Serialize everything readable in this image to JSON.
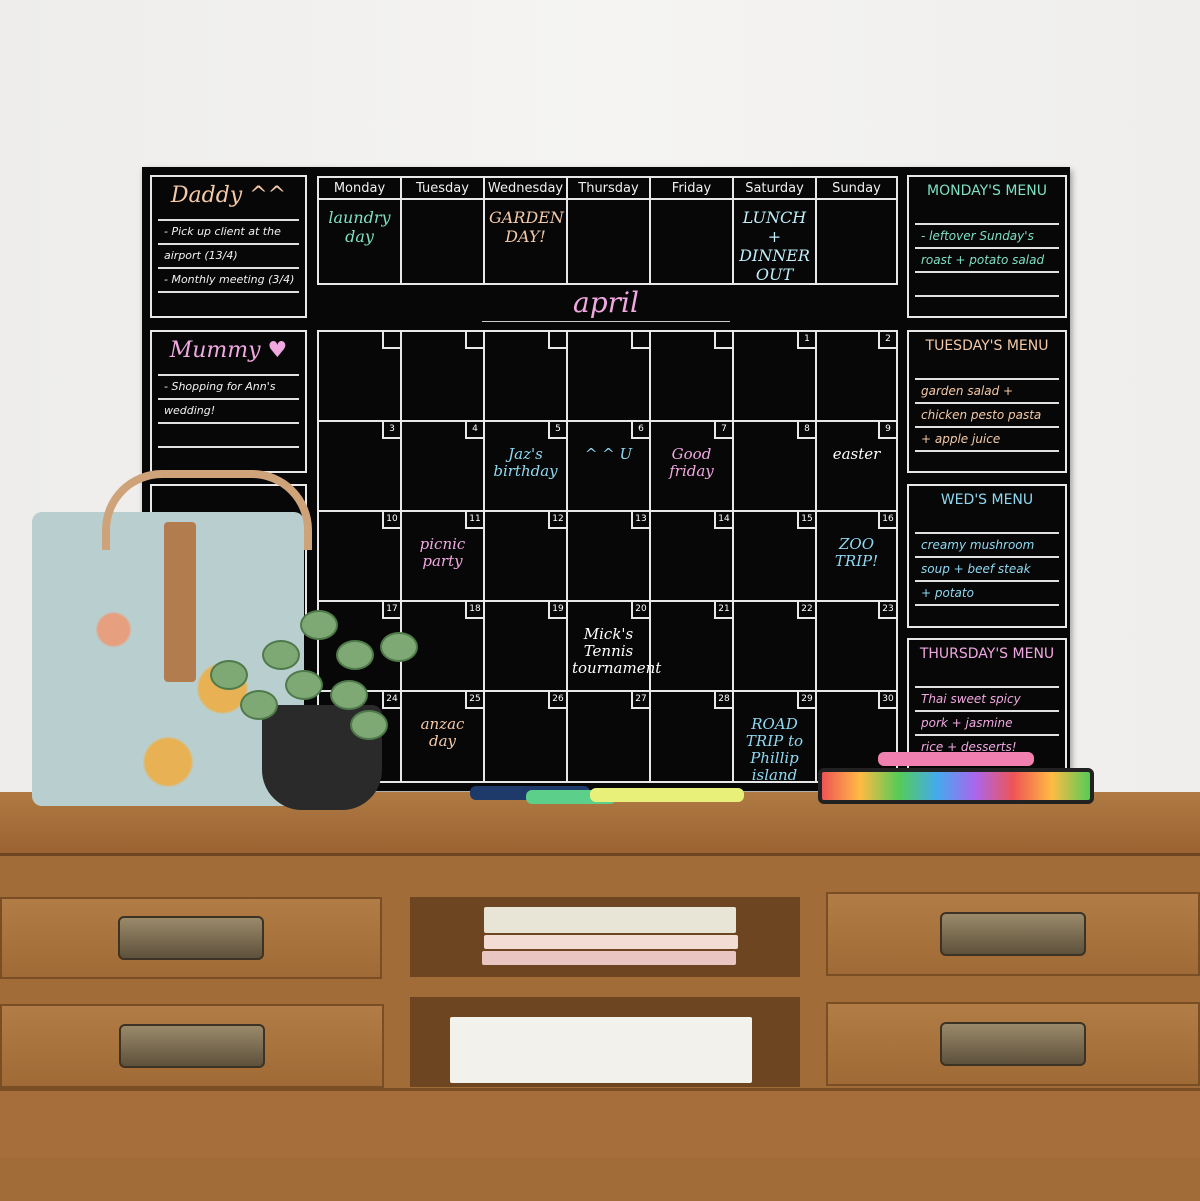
{
  "planner": {
    "daddy": {
      "title": "Daddy ^^",
      "lines": [
        "- Pick up client at the",
        "airport (13/4)",
        "- Monthly meeting (3/4)",
        ""
      ]
    },
    "mummy": {
      "title": "Mummy ♥",
      "lines": [
        "- Shopping for Ann's",
        "wedding!",
        "",
        ""
      ]
    },
    "week": {
      "days": [
        "Monday",
        "Tuesday",
        "Wednesday",
        "Thursday",
        "Friday",
        "Saturday",
        "Sunday"
      ],
      "events": [
        "laundry day",
        "",
        "GARDEN DAY!",
        "",
        "",
        "LUNCH + DINNER OUT",
        ""
      ]
    },
    "month": "april",
    "calendar": {
      "numbers": [
        "",
        "",
        "",
        "",
        "",
        "1",
        "2",
        "3",
        "4",
        "5",
        "6",
        "7",
        "8",
        "9",
        "10",
        "11",
        "12",
        "13",
        "14",
        "15",
        "16",
        "17",
        "18",
        "19",
        "20",
        "21",
        "22",
        "23",
        "24",
        "25",
        "26",
        "27",
        "28",
        "29",
        "30"
      ],
      "events": {
        "5": "Jaz's birthday",
        "7": "Good friday",
        "9": "easter",
        "11": "picnic party",
        "16": "ZOO TRIP!",
        "20": "Mick's Tennis tournament",
        "25": "anzac day",
        "29": "ROAD TRIP to Phillip island",
        "6": "^ ^ U"
      }
    },
    "menus": [
      {
        "title": "MONDAY'S MENU",
        "color": "#7fe0c4",
        "lines": [
          "- leftover Sunday's",
          "roast + potato salad",
          "",
          ""
        ]
      },
      {
        "title": "TUESDAY'S MENU",
        "color": "#f3c9a8",
        "lines": [
          "garden salad +",
          "chicken pesto pasta",
          "+ apple juice",
          ""
        ]
      },
      {
        "title": "WED'S MENU",
        "color": "#8fd8f2",
        "lines": [
          "creamy mushroom",
          "soup + beef steak",
          "+ potato",
          ""
        ]
      },
      {
        "title": "THURSDAY'S MENU",
        "color": "#f0a8e0",
        "lines": [
          "Thai sweet spicy",
          "pork + jasmine",
          "rice + desserts!"
        ]
      }
    ]
  },
  "colors": {
    "board": "#070707",
    "wood": "#a26c38",
    "wall": "#f1f0ee",
    "teal": "#7fe0c4",
    "peach": "#f3c9a8",
    "pink": "#f0a8e0",
    "blue": "#8fd8f2"
  }
}
